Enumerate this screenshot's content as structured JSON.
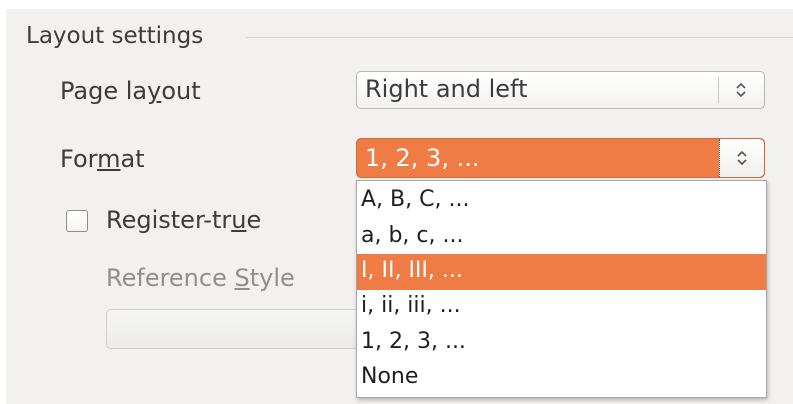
{
  "section": {
    "title": "Layout settings"
  },
  "page_layout": {
    "label_pre": "Page la",
    "label_mnemonic": "y",
    "label_post": "out",
    "value": "Right and left",
    "spin_icon": "spin-up-down-icon"
  },
  "format": {
    "label_pre": "For",
    "label_mnemonic": "m",
    "label_post": "at",
    "value": "1, 2, 3, ...",
    "spin_icon": "spin-up-down-icon",
    "options": [
      "A, B, C, ...",
      "a, b, c, ...",
      "I, II, III, ...",
      "i, ii, iii, ...",
      "1, 2, 3, ...",
      "None"
    ],
    "highlighted_option": "I, II, III, ..."
  },
  "register_true": {
    "label_pre": "Register-tr",
    "label_mnemonic": "u",
    "label_post": "e",
    "checked": false
  },
  "reference_style": {
    "label_pre": "Reference ",
    "label_mnemonic": "S",
    "label_post": "tyle",
    "value": ""
  },
  "colors": {
    "accent": "#ef7b45",
    "panel_background": "#f2f1f0",
    "text": "#3c3c3c",
    "disabled_text": "#8f8f8f"
  }
}
